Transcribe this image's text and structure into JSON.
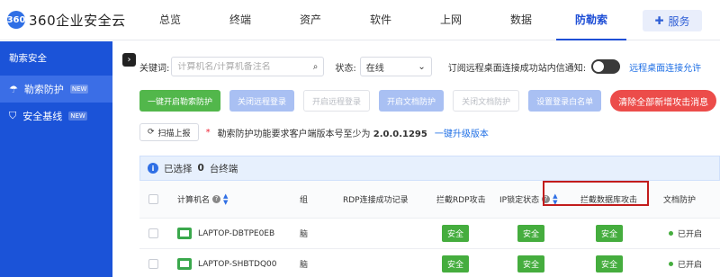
{
  "app": {
    "logo_mark": "360",
    "logo_text": "360企业安全云"
  },
  "nav": {
    "items": [
      "总览",
      "终端",
      "资产",
      "软件",
      "上网",
      "数据",
      "防勒索"
    ],
    "active_index": 6,
    "service_label": "服务"
  },
  "sidebar": {
    "header": "勒索安全",
    "items": [
      {
        "label": "勒索防护",
        "tag": "NEW",
        "icon": "umbrella-icon"
      },
      {
        "label": "安全基线",
        "tag": "NEW",
        "icon": "shield-icon"
      }
    ]
  },
  "filters": {
    "keyword_label": "关键词:",
    "keyword_placeholder": "计算机名/计算机备注名",
    "state_label": "状态:",
    "state_value": "在线",
    "subscribe_label": "订阅远程桌面连接成功站内信通知:",
    "subscribe_link": "远程桌面连接允许"
  },
  "actions": {
    "one_click": "一键开启勒索防护",
    "close_remote": "关闭远程登录",
    "open_remote": "开启远程登录",
    "open_doc": "开启文档防护",
    "close_doc": "关闭文档防护",
    "whitelist": "设置登录白名单",
    "clear_all": "清除全部新增攻击消息"
  },
  "info": {
    "scan_label": "扫描上报",
    "required_mark": "*",
    "notice_prefix": "勒索防护功能要求客户端版本号至少为",
    "notice_version": "2.0.0.1295",
    "upgrade_link": "一键升级版本"
  },
  "selection": {
    "prefix": "已选择",
    "count": "0",
    "suffix": "台终端"
  },
  "table": {
    "headers": {
      "name": "计算机名",
      "group": "组",
      "rdp_log": "RDP连接成功记录",
      "block_rdp": "拦截RDP攻击",
      "ip_lock": "IP锁定状态",
      "block_db": "拦截数据库攻击",
      "doc_protect": "文档防护"
    },
    "rows": [
      {
        "name": "LAPTOP-DBTPE0EB",
        "group": "脑",
        "block_rdp": "安全",
        "ip_lock": "安全",
        "block_db": "安全",
        "doc_protect": "已开启"
      },
      {
        "name": "LAPTOP-SHBTDQ00",
        "group": "脑",
        "block_rdp": "安全",
        "ip_lock": "安全",
        "block_db": "安全",
        "doc_protect": "已开启"
      }
    ]
  },
  "colors": {
    "primary": "#1b53d8",
    "green": "#45ad3e",
    "red": "#ec4c4a"
  }
}
